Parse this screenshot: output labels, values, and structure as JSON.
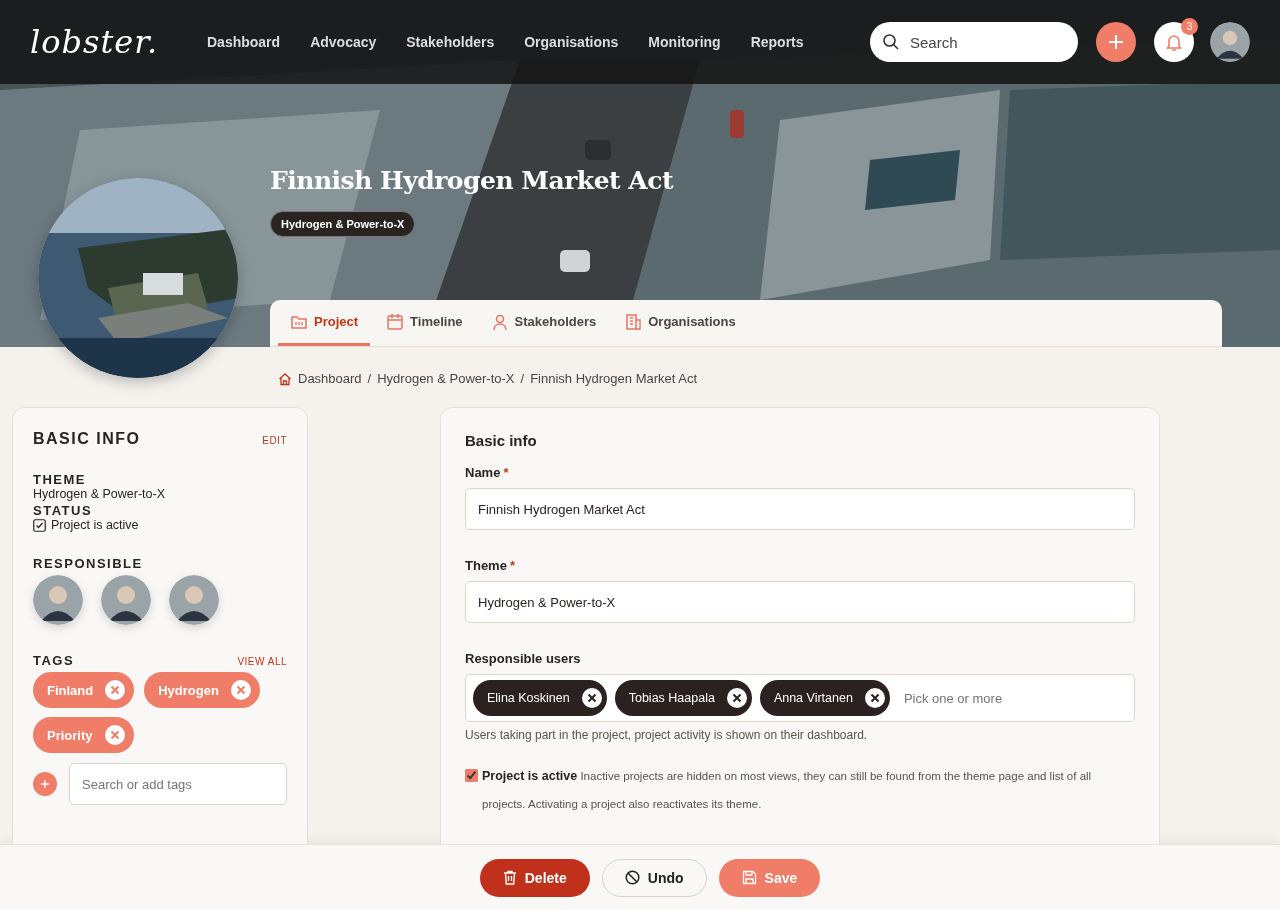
{
  "logo": "lobster.",
  "nav": [
    {
      "label": "Dashboard"
    },
    {
      "label": "Advocacy"
    },
    {
      "label": "Stakeholders"
    },
    {
      "label": "Organisations"
    },
    {
      "label": "Monitoring"
    },
    {
      "label": "Reports"
    }
  ],
  "search": {
    "placeholder": "Search"
  },
  "notifications": {
    "count": "3"
  },
  "project": {
    "title": "Finnish Hydrogen Market Act",
    "theme_badge": "Hydrogen & Power-to-X"
  },
  "tabs": [
    {
      "label": "Project",
      "selected": true
    },
    {
      "label": "Timeline",
      "selected": false
    },
    {
      "label": "Stakeholders",
      "selected": false
    },
    {
      "label": "Organisations",
      "selected": false
    }
  ],
  "breadcrumb": [
    {
      "label": "Dashboard"
    },
    {
      "label": "Hydrogen & Power-to-X"
    },
    {
      "label": "Finnish Hydrogen Market Act"
    }
  ],
  "breadcrumb_separator": "/",
  "basic_info": {
    "title": "BASIC INFO",
    "edit": "EDIT",
    "theme_label": "THEME",
    "theme": "Hydrogen & Power-to-X",
    "status_label": "STATUS",
    "status": {
      "label": "Project is active",
      "checked": true
    },
    "responsible_label": "RESPONSIBLE",
    "responsible": [
      {
        "kind": "picture"
      },
      {
        "kind": "picture"
      },
      {
        "kind": "picture"
      }
    ],
    "tags_label": "TAGS",
    "view_all": "VIEW ALL",
    "tags": [
      "Finland",
      "Hydrogen",
      "Priority"
    ],
    "tag_search": {
      "placeholder": "Search or add tags"
    }
  },
  "form": {
    "title": "Basic info",
    "fields": [
      {
        "label": "Name",
        "required_mark": "*",
        "value": "Finnish Hydrogen Market Act"
      },
      {
        "label": "Theme",
        "required_mark": "*",
        "value": "Hydrogen & Power-to-X"
      }
    ],
    "responsible_users": {
      "label": "Responsible users",
      "chips": [
        "Elina Koskinen",
        "Tobias Haapala",
        "Anna Virtanen"
      ],
      "placeholder": "Pick one or more",
      "help": "Users taking part in the project, project activity is shown on their dashboard."
    },
    "active": {
      "checked": true,
      "label": "Project is active",
      "description": "Inactive projects are hidden on most views, they can still be found from the theme page and list of all projects. Activating a project also reactivates its theme."
    }
  },
  "actions": [
    {
      "label": "Delete",
      "kind": "delete"
    },
    {
      "label": "Undo",
      "kind": "undo"
    },
    {
      "label": "Save",
      "kind": "save"
    }
  ]
}
